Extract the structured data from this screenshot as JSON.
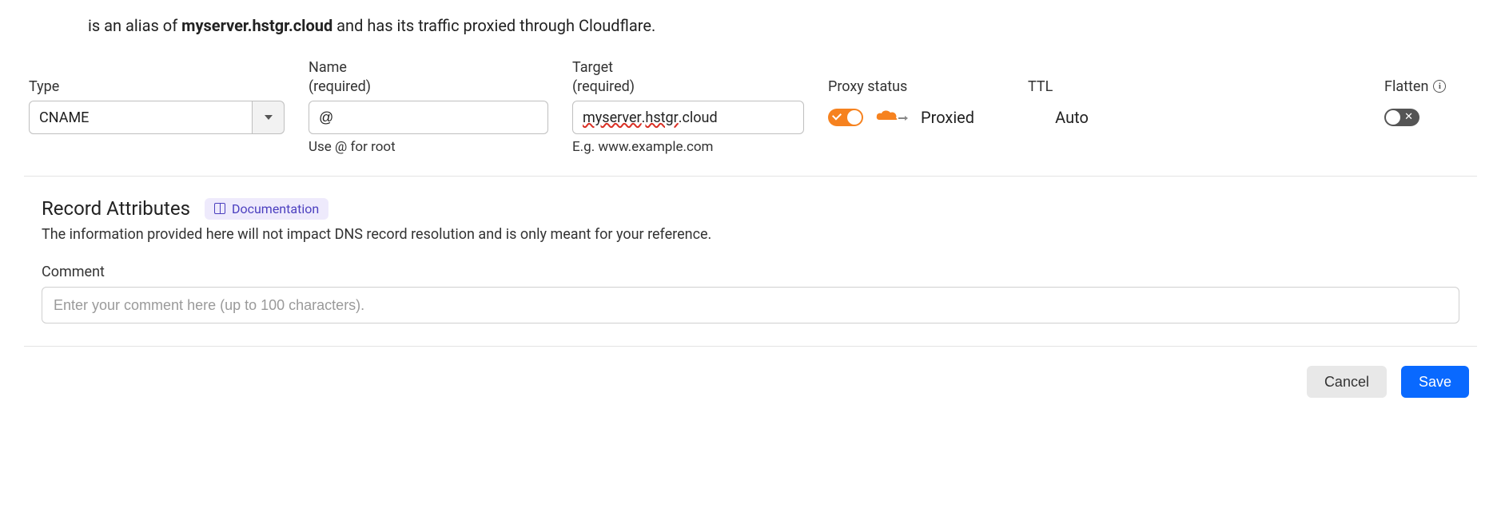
{
  "description": {
    "prefix": "is an alias of ",
    "hostname": "myserver.hstgr.cloud",
    "suffix": " and has its traffic proxied through Cloudflare."
  },
  "fields": {
    "type": {
      "label": "Type",
      "value": "CNAME"
    },
    "name": {
      "label": "Name",
      "required_hint": "(required)",
      "value": "@",
      "helper": "Use @ for root"
    },
    "target": {
      "label": "Target",
      "required_hint": "(required)",
      "value_parts": {
        "spellchecked": "myserver",
        "dot1": ".",
        "spellchecked2": "hstgr",
        "rest": ".cloud"
      },
      "helper": "E.g. www.example.com"
    },
    "proxy": {
      "label": "Proxy status",
      "status_text": "Proxied",
      "enabled": true
    },
    "ttl": {
      "label": "TTL",
      "value": "Auto"
    },
    "flatten": {
      "label": "Flatten",
      "enabled": false
    }
  },
  "attributes": {
    "title": "Record Attributes",
    "doc_link": "Documentation",
    "description": "The information provided here will not impact DNS record resolution and is only meant for your reference.",
    "comment_label": "Comment",
    "comment_placeholder": "Enter your comment here (up to 100 characters).",
    "comment_value": ""
  },
  "buttons": {
    "cancel": "Cancel",
    "save": "Save"
  }
}
